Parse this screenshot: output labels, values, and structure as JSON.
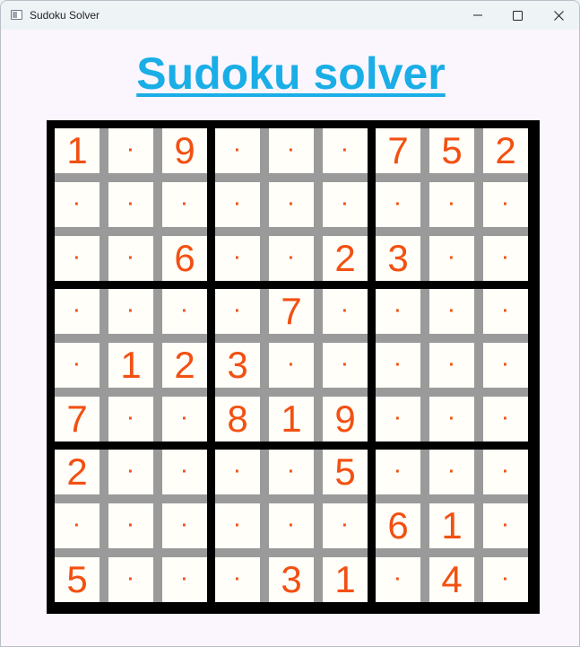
{
  "window": {
    "title": "Sudoku Solver",
    "controls": [
      "minimize-icon",
      "maximize-icon",
      "close-icon"
    ]
  },
  "heading": "Sudoku solver",
  "colors": {
    "heading": "#1aaee6",
    "digit": "#f25012",
    "cell_background": "#fffef8",
    "thin_line": "#9a9a9a",
    "thick_line": "#000000",
    "window_background": "#fbf6fe"
  },
  "board": {
    "rows": [
      [
        "1",
        "·",
        "9",
        "·",
        "·",
        "·",
        "7",
        "5",
        "2"
      ],
      [
        "·",
        "·",
        "·",
        "·",
        "·",
        "·",
        "·",
        "·",
        "·"
      ],
      [
        "·",
        "·",
        "6",
        "·",
        "·",
        "2",
        "3",
        "·",
        "·"
      ],
      [
        "·",
        "·",
        "·",
        "·",
        "7",
        "·",
        "·",
        "·",
        "·"
      ],
      [
        "·",
        "1",
        "2",
        "3",
        "·",
        "·",
        "·",
        "·",
        "·"
      ],
      [
        "7",
        "·",
        "·",
        "8",
        "1",
        "9",
        "·",
        "·",
        "·"
      ],
      [
        "2",
        "·",
        "·",
        "·",
        "·",
        "5",
        "·",
        "·",
        "·"
      ],
      [
        "·",
        "·",
        "·",
        "·",
        "·",
        "·",
        "6",
        "1",
        "·"
      ],
      [
        "5",
        "·",
        "·",
        "·",
        "3",
        "1",
        "·",
        "4",
        "·"
      ]
    ]
  }
}
